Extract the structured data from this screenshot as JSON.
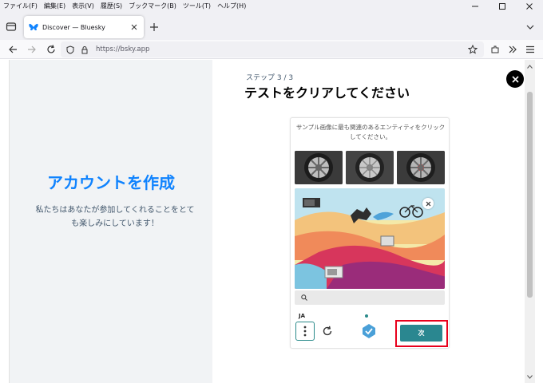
{
  "menubar": {
    "items": [
      "ファイル(F)",
      "編集(E)",
      "表示(V)",
      "履歴(S)",
      "ブックマーク(B)",
      "ツール(T)",
      "ヘルプ(H)"
    ]
  },
  "tab": {
    "title": "Discover — Bluesky"
  },
  "urlbar": {
    "url": "https://bsky.app"
  },
  "left": {
    "title": "アカウントを作成",
    "subtitle": "私たちはあなたが参加してくれることをとても楽しみにしています！"
  },
  "dialog": {
    "step": "ステップ 3 / 3",
    "title": "テストをクリアしてください"
  },
  "captcha": {
    "prompt": "サンプル画像に最も関連のあるエンティティをクリックしてください。",
    "language": "JA",
    "next_label": "次"
  },
  "colors": {
    "accent": "#1083fe",
    "captcha_teal": "#2a8790",
    "highlight_red": "#e8001c"
  }
}
